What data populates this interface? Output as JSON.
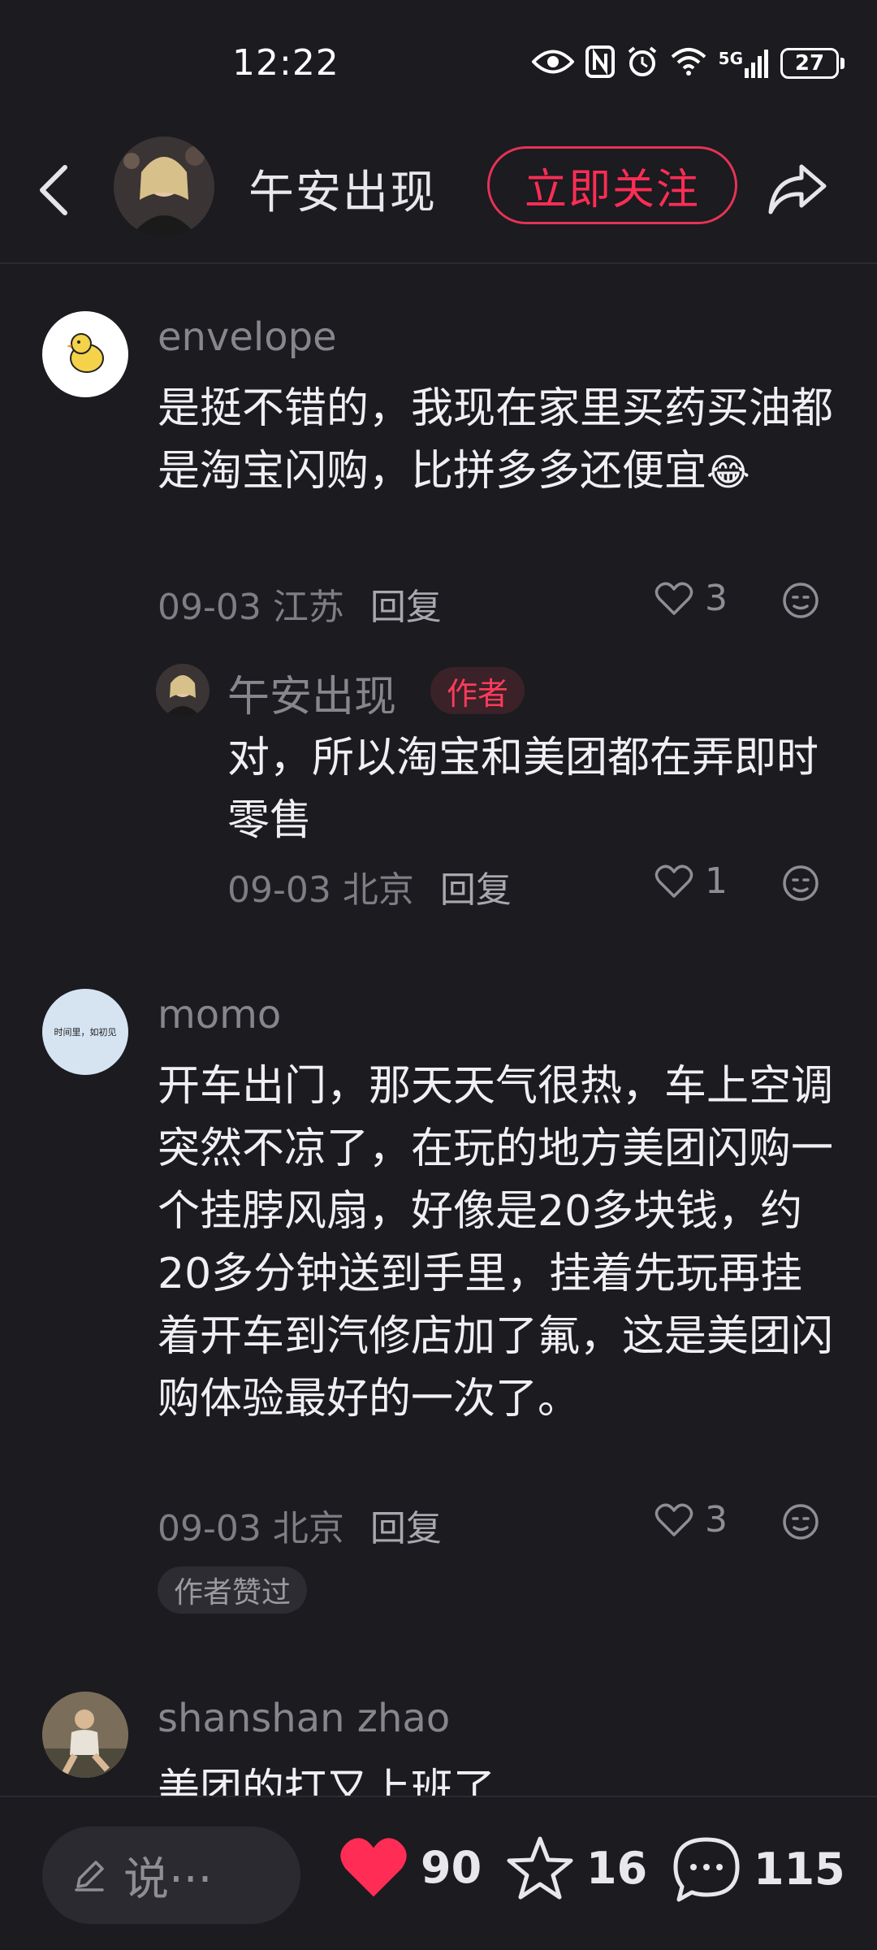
{
  "status_bar": {
    "time": "12:22",
    "signal_label": "5G",
    "battery": "27"
  },
  "header": {
    "name": "午安出现",
    "follow_label": "立即关注"
  },
  "comments": [
    {
      "user": "envelope",
      "text": "是挺不错的，我现在家里买药买油都是淘宝闪购，比拼多多还便宜",
      "emoji": "😂",
      "date": "09-03",
      "location": "江苏",
      "reply_label": "回复",
      "likes": "3"
    },
    {
      "user": "午安出现",
      "tag": "作者",
      "text": "对，所以淘宝和美团都在弄即时零售",
      "date": "09-03",
      "location": "北京",
      "reply_label": "回复",
      "likes": "1"
    },
    {
      "user": "momo",
      "avatar_text": "时间里，如初见",
      "text": "开车出门，那天天气很热，车上空调突然不凉了，在玩的地方美团闪购一个挂脖风扇，好像是20多块钱，约20多分钟送到手里，挂着先玩再挂着开车到汽修店加了氟，这是美团闪购体验最好的一次了。",
      "date": "09-03",
      "location": "北京",
      "reply_label": "回复",
      "likes": "3",
      "liked_by_author": "作者赞过"
    },
    {
      "user": "shanshan zhao",
      "text": "美团的打又上班了"
    }
  ],
  "bottom_bar": {
    "input_placeholder": "说···",
    "like_count": "90",
    "star_count": "16",
    "comment_count": "115"
  },
  "colors": {
    "background": "#1b1b20",
    "accent": "#ff2d55"
  }
}
